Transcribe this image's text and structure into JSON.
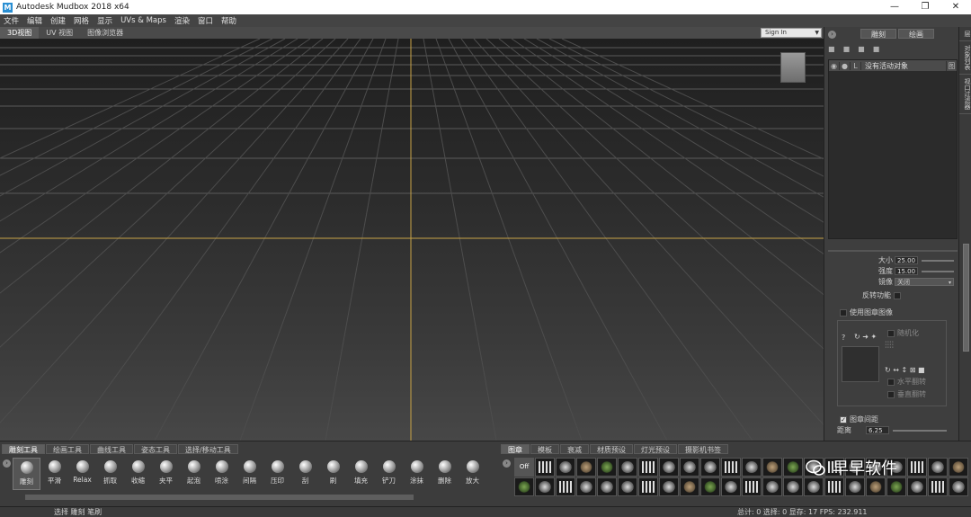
{
  "window": {
    "title": "Autodesk Mudbox 2018 x64",
    "minimize": "—",
    "maximize": "❐",
    "close": "✕"
  },
  "menu": [
    "文件",
    "编辑",
    "创建",
    "网格",
    "显示",
    "UVs & Maps",
    "渲染",
    "窗口",
    "帮助"
  ],
  "view_tabs": [
    "3D视图",
    "UV 视图",
    "图像浏览器"
  ],
  "sign_in": "Sign In",
  "right_panel": {
    "tabs": [
      "雕刻",
      "绘画"
    ],
    "object_row": {
      "label": "没有活动对象",
      "button": "图"
    },
    "props": {
      "size_label": "大小",
      "size_value": "25.00",
      "strength_label": "强度",
      "strength_value": "15.00",
      "mirror_label": "镜像",
      "mirror_value": "关闭",
      "invert_label": "反转功能",
      "use_stamp_label": "使用图章图像",
      "randomize_label": "随机化",
      "tile_h_label": "水平翻转",
      "tile_v_label": "垂直翻转",
      "stroke_spacing_label": "图章间距",
      "distance_label": "距离",
      "distance_value": "6.25"
    }
  },
  "side_tabs": [
    "层",
    "对象列表",
    "视口过滤器"
  ],
  "tool_tabs": [
    "雕刻工具",
    "绘画工具",
    "曲线工具",
    "姿态工具",
    "选择/移动工具"
  ],
  "tools": [
    "雕刻",
    "平滑",
    "Relax",
    "抓取",
    "收缩",
    "夹平",
    "起泡",
    "喷涂",
    "间隔",
    "压印",
    "刮",
    "刷",
    "填充",
    "铲刀",
    "涂抹",
    "删除",
    "放大"
  ],
  "stamp_tabs": [
    "图章",
    "模板",
    "衰减",
    "材质预设",
    "灯光预设",
    "摄影机书签"
  ],
  "stamp_off": "Off",
  "status": {
    "left": "选择 雕刻 笔刷",
    "right": "总计: 0  选择: 0 显存: 17  FPS: 232.911"
  },
  "watermark": "早早软件"
}
